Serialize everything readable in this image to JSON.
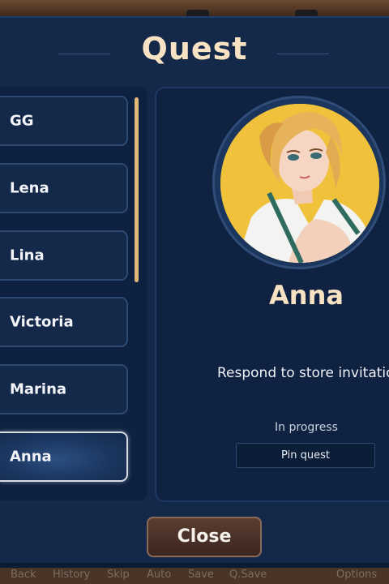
{
  "screen": {
    "title": "Quest"
  },
  "characters": [
    "GG",
    "Lena",
    "Lina",
    "Victoria",
    "Marina",
    "Anna"
  ],
  "selected_character": "Anna",
  "detail": {
    "name": "Anna",
    "quest_text": "Respond to store invitation",
    "status": "In progress",
    "pin_label": "Pin quest"
  },
  "close_label": "Close",
  "quick_menu": [
    "Back",
    "History",
    "Skip",
    "Auto",
    "Save",
    "Q.Save",
    "Options"
  ],
  "colors": {
    "background": "#0d1c35",
    "title": "#f7e3c4",
    "scroll_thumb": "#e2b877",
    "portrait_bg": "#f0c23c"
  }
}
